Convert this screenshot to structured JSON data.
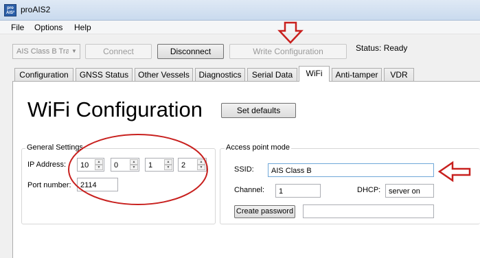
{
  "window": {
    "title": "proAIS2",
    "icon_text": "pro AIS²"
  },
  "menu": [
    "File",
    "Options",
    "Help"
  ],
  "toolbar": {
    "device_select": "AIS Class B Tran",
    "connect_label": "Connect",
    "disconnect_label": "Disconnect",
    "write_label": "Write Configuration",
    "status_text": "Status: Ready"
  },
  "tabs": [
    "Configuration",
    "GNSS Status",
    "Other Vessels",
    "Diagnostics",
    "Serial Data",
    "WiFi",
    "Anti-tamper",
    "VDR"
  ],
  "active_tab": "WiFi",
  "page": {
    "title": "WiFi Configuration",
    "set_defaults_label": "Set defaults"
  },
  "general": {
    "title": "General Settings",
    "ip_label": "IP Address:",
    "ip_octets": [
      "10",
      "0",
      "1",
      "2"
    ],
    "port_label": "Port number:",
    "port_value": "2114"
  },
  "ap": {
    "title": "Access point mode",
    "ssid_label": "SSID:",
    "ssid_value": "AIS Class B",
    "channel_label": "Channel:",
    "channel_value": "1",
    "dhcp_label": "DHCP:",
    "dhcp_value": "server on",
    "create_password_label": "Create password",
    "password_value": ""
  },
  "annotation_color": "#c8201e"
}
